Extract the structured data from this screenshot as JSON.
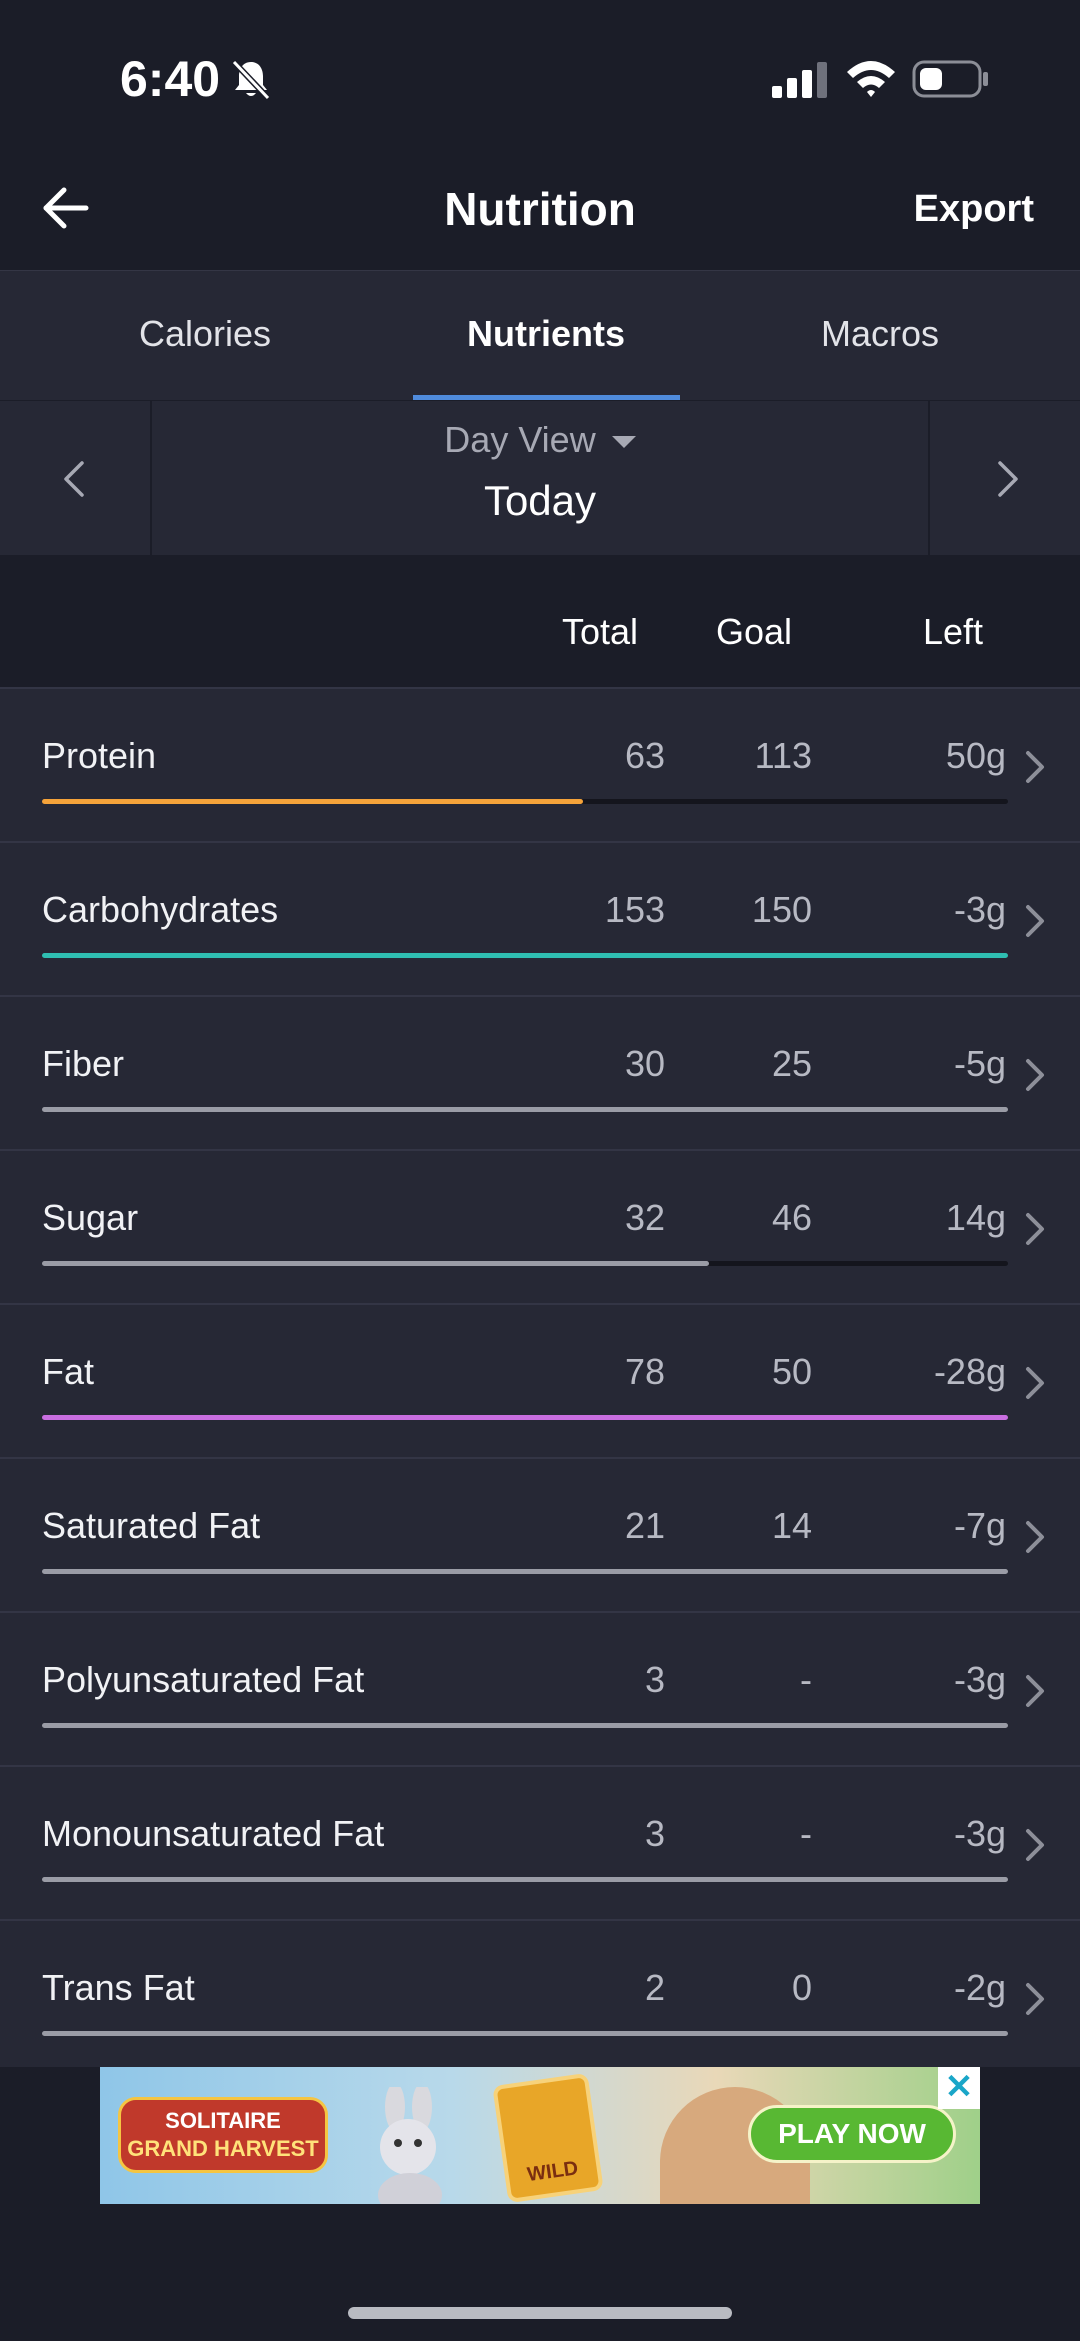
{
  "status_bar": {
    "time": "6:40"
  },
  "header": {
    "title": "Nutrition",
    "export_label": "Export"
  },
  "tabs": [
    {
      "label": "Calories",
      "active": false
    },
    {
      "label": "Nutrients",
      "active": true
    },
    {
      "label": "Macros",
      "active": false
    }
  ],
  "day_selector": {
    "view_label": "Day View",
    "date_label": "Today"
  },
  "columns": {
    "total": "Total",
    "goal": "Goal",
    "left": "Left"
  },
  "nutrients": [
    {
      "name": "Protein",
      "total": "63",
      "goal": "113",
      "left": "50g",
      "progress": 0.56,
      "color": "#f5a33a"
    },
    {
      "name": "Carbohydrates",
      "total": "153",
      "goal": "150",
      "left": "-3g",
      "progress": 1.0,
      "color": "#2fbfb2"
    },
    {
      "name": "Fiber",
      "total": "30",
      "goal": "25",
      "left": "-5g",
      "progress": 1.0,
      "color": "#9a9ca6"
    },
    {
      "name": "Sugar",
      "total": "32",
      "goal": "46",
      "left": "14g",
      "progress": 0.69,
      "color": "#9a9ca6"
    },
    {
      "name": "Fat",
      "total": "78",
      "goal": "50",
      "left": "-28g",
      "progress": 1.0,
      "color": "#c86ee0"
    },
    {
      "name": "Saturated Fat",
      "total": "21",
      "goal": "14",
      "left": "-7g",
      "progress": 1.0,
      "color": "#9a9ca6"
    },
    {
      "name": "Polyunsaturated Fat",
      "total": "3",
      "goal": "-",
      "left": "-3g",
      "progress": 1.0,
      "color": "#9a9ca6"
    },
    {
      "name": "Monounsaturated Fat",
      "total": "3",
      "goal": "-",
      "left": "-3g",
      "progress": 1.0,
      "color": "#9a9ca6"
    },
    {
      "name": "Trans Fat",
      "total": "2",
      "goal": "0",
      "left": "-2g",
      "progress": 1.0,
      "color": "#9a9ca6"
    }
  ],
  "ad": {
    "logo_line1": "SOLITAIRE",
    "logo_line2": "GRAND HARVEST",
    "card_text": "WILD",
    "cta": "PLAY NOW",
    "close": "✕"
  },
  "icons": {
    "back": "back-arrow-icon",
    "export": "export",
    "prev_day": "chevron-left-icon",
    "next_day": "chevron-right-icon",
    "row_chevron": "chevron-right-icon"
  }
}
